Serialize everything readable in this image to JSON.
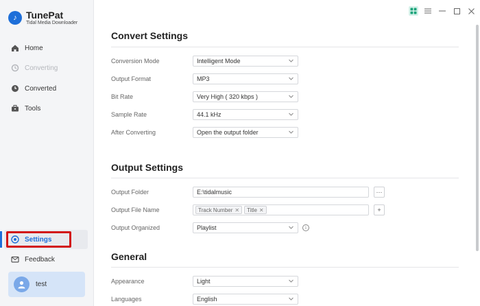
{
  "app": {
    "name": "TunePat",
    "subtitle": "Tidal Media Downloader"
  },
  "sidebar": {
    "items": [
      {
        "label": "Home",
        "icon": "home-icon",
        "state": "normal"
      },
      {
        "label": "Converting",
        "icon": "converting-icon",
        "state": "disabled"
      },
      {
        "label": "Converted",
        "icon": "clock-icon",
        "state": "normal"
      },
      {
        "label": "Tools",
        "icon": "toolbox-icon",
        "state": "normal"
      },
      {
        "label": "Settings",
        "icon": "settings-icon",
        "state": "active"
      },
      {
        "label": "Feedback",
        "icon": "mail-icon",
        "state": "normal"
      }
    ],
    "user": {
      "name": "test"
    }
  },
  "colors": {
    "accent": "#1e6fd9",
    "highlight": "#d21414",
    "user_card": "#d5e4f8"
  },
  "convert_settings": {
    "title": "Convert Settings",
    "conversion_mode": {
      "label": "Conversion Mode",
      "value": "Intelligent Mode"
    },
    "output_format": {
      "label": "Output Format",
      "value": "MP3"
    },
    "bit_rate": {
      "label": "Bit Rate",
      "value": "Very High ( 320 kbps )"
    },
    "sample_rate": {
      "label": "Sample Rate",
      "value": "44.1 kHz"
    },
    "after_converting": {
      "label": "After Converting",
      "value": "Open the output folder"
    }
  },
  "output_settings": {
    "title": "Output Settings",
    "output_folder": {
      "label": "Output Folder",
      "value": "E:\\tidalmusic",
      "browse": "···"
    },
    "output_file_name": {
      "label": "Output File Name",
      "tags": [
        "Track Number",
        "Title"
      ],
      "add": "+"
    },
    "output_organized": {
      "label": "Output Organized",
      "value": "Playlist",
      "info": "i"
    }
  },
  "general": {
    "title": "General",
    "appearance": {
      "label": "Appearance",
      "value": "Light"
    },
    "languages": {
      "label": "Languages",
      "value": "English"
    }
  }
}
